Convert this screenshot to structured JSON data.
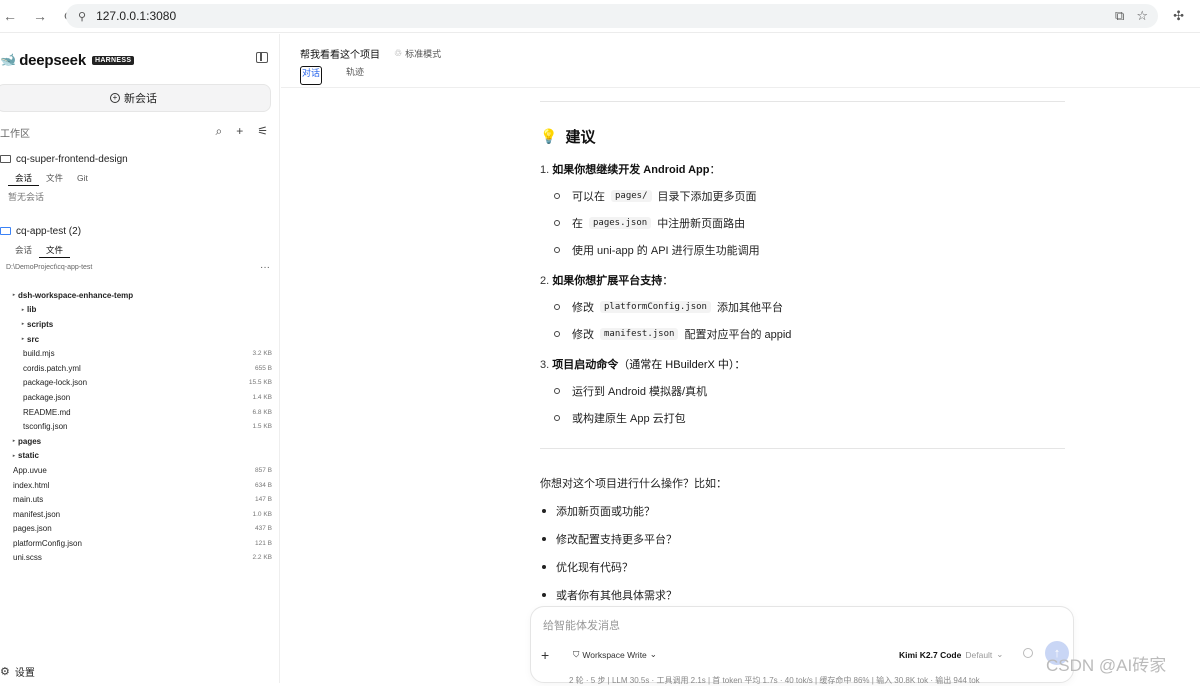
{
  "browser": {
    "url": "127.0.0.1:3080",
    "nav_back": "←",
    "nav_forward": "→",
    "reload": "C"
  },
  "sidebar": {
    "brand": "deepseek",
    "brand_badge": "HARNESS",
    "new_chat_label": "新会话",
    "workspace_title": "工作区",
    "projects": [
      {
        "name": "cq-super-frontend-design",
        "tabs": [
          "会话",
          "文件",
          "Git"
        ],
        "active_tab": "会话",
        "empty_note": "暂无会话"
      },
      {
        "name": "cq-app-test (2)",
        "tabs": [
          "会话",
          "文件"
        ],
        "active_tab": "文件",
        "path": "D:\\DemoProject\\cq-app-test",
        "more": "···"
      }
    ],
    "tree": [
      {
        "name": "dsh-workspace-enhance-temp",
        "folder": true,
        "level": 1,
        "size": ""
      },
      {
        "name": "lib",
        "folder": true,
        "level": 2,
        "size": ""
      },
      {
        "name": "scripts",
        "folder": true,
        "level": 2,
        "size": ""
      },
      {
        "name": "src",
        "folder": true,
        "level": 2,
        "size": ""
      },
      {
        "name": "build.mjs",
        "folder": false,
        "level": 2,
        "size": "3.2 KB"
      },
      {
        "name": "cordis.patch.yml",
        "folder": false,
        "level": 2,
        "size": "655 B"
      },
      {
        "name": "package-lock.json",
        "folder": false,
        "level": 2,
        "size": "15.5 KB"
      },
      {
        "name": "package.json",
        "folder": false,
        "level": 2,
        "size": "1.4 KB"
      },
      {
        "name": "README.md",
        "folder": false,
        "level": 2,
        "size": "6.8 KB"
      },
      {
        "name": "tsconfig.json",
        "folder": false,
        "level": 2,
        "size": "1.5 KB"
      },
      {
        "name": "pages",
        "folder": true,
        "level": 1,
        "size": ""
      },
      {
        "name": "static",
        "folder": true,
        "level": 1,
        "size": ""
      },
      {
        "name": "App.uvue",
        "folder": false,
        "level": 0,
        "size": "857 B"
      },
      {
        "name": "index.html",
        "folder": false,
        "level": 0,
        "size": "634 B"
      },
      {
        "name": "main.uts",
        "folder": false,
        "level": 0,
        "size": "147 B"
      },
      {
        "name": "manifest.json",
        "folder": false,
        "level": 0,
        "size": "1.0 KB"
      },
      {
        "name": "pages.json",
        "folder": false,
        "level": 0,
        "size": "437 B"
      },
      {
        "name": "platformConfig.json",
        "folder": false,
        "level": 0,
        "size": "121 B"
      },
      {
        "name": "uni.scss",
        "folder": false,
        "level": 0,
        "size": "2.2 KB"
      }
    ],
    "settings_label": "设置"
  },
  "main": {
    "topic_title": "帮我看看这个项目",
    "mode_label": "标准模式",
    "tabs": [
      "对话",
      "轨迹"
    ],
    "active_tab": "对话",
    "heading": "建议",
    "sections": [
      {
        "num": "1.",
        "title": "如果你想继续开发 Android App",
        "suffix": "：",
        "items": [
          {
            "pre": "可以在",
            "code": "pages/",
            "post": "目录下添加更多页面"
          },
          {
            "pre": "在",
            "code": "pages.json",
            "post": "中注册新页面路由"
          },
          {
            "pre": "使用 uni-app 的 API 进行原生功能调用",
            "code": "",
            "post": ""
          }
        ]
      },
      {
        "num": "2.",
        "title": "如果你想扩展平台支持",
        "suffix": "：",
        "items": [
          {
            "pre": "修改",
            "code": "platformConfig.json",
            "post": "添加其他平台"
          },
          {
            "pre": "修改",
            "code": "manifest.json",
            "post": "配置对应平台的 appid"
          }
        ]
      },
      {
        "num": "3.",
        "title": "项目启动命令",
        "suffix": "（通常在 HBuilderX 中）：",
        "items": [
          {
            "pre": "运行到 Android 模拟器/真机",
            "code": "",
            "post": ""
          },
          {
            "pre": "或构建原生 App 云打包",
            "code": "",
            "post": ""
          }
        ]
      }
    ],
    "question": "你想对这个项目进行什么操作？比如：",
    "bullets": [
      "添加新页面或功能？",
      "修改配置支持更多平台？",
      "优化现有代码？",
      "或者你有其他具体需求？"
    ]
  },
  "composer": {
    "placeholder": "给智能体发消息",
    "mode": "Workspace Write",
    "model": "Kimi K2.7 Code",
    "model_sub": "Default"
  },
  "statusbar": "2 轮 · 5 步  |  LLM 30.5s · 工具调用 2.1s  |  首 token 平均 1.7s · 40 tok/s  |  缓存命中 86%  |  输入 30.8K tok · 输出 944 tok",
  "watermark": "CSDN @AI砖家"
}
